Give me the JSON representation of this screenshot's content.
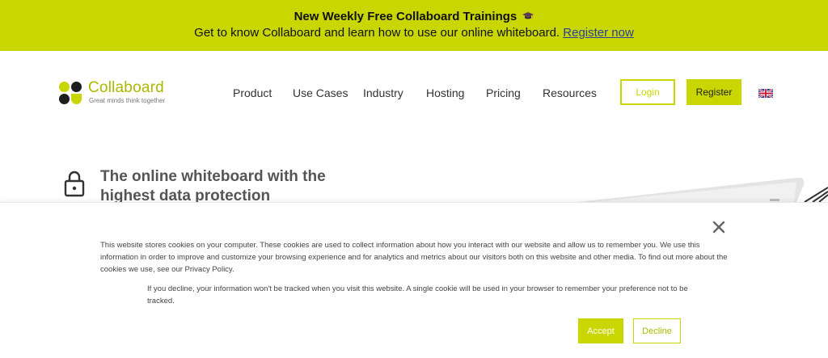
{
  "banner": {
    "title": "New Weekly Free Collaboard Trainings",
    "text": "Get to know Collaboard and learn how to use our online whiteboard.",
    "link": "Register now"
  },
  "header": {
    "logo_name": "Collaboard",
    "logo_tagline": "Great minds think together",
    "nav": [
      "Product",
      "Use Cases",
      "Industry",
      "Hosting",
      "Pricing",
      "Resources"
    ],
    "login": "Login",
    "register": "Register"
  },
  "hero": {
    "title": "The online whiteboard with the highest data protection"
  },
  "cookie": {
    "main_text": "This website stores cookies on your computer. These cookies are used to collect information about how you interact with our website and allow us to remember you. We use this information in order to improve and customize your browsing experience and for analytics and metrics about our visitors both on this website and other media. To find out more about the cookies we use, see our Privacy Policy.",
    "sub_text": "If you decline, your information won't be tracked when you visit this website. A single cookie will be used in your browser to remember your preference not to be tracked.",
    "accept": "Accept",
    "decline": "Decline"
  },
  "colors": {
    "brand": "#c9d600",
    "link": "#2a3f9e"
  },
  "icons": {
    "banner": "graduation-cap-icon",
    "hero": "lock-icon",
    "close": "close-icon",
    "language": "uk-flag-icon"
  }
}
